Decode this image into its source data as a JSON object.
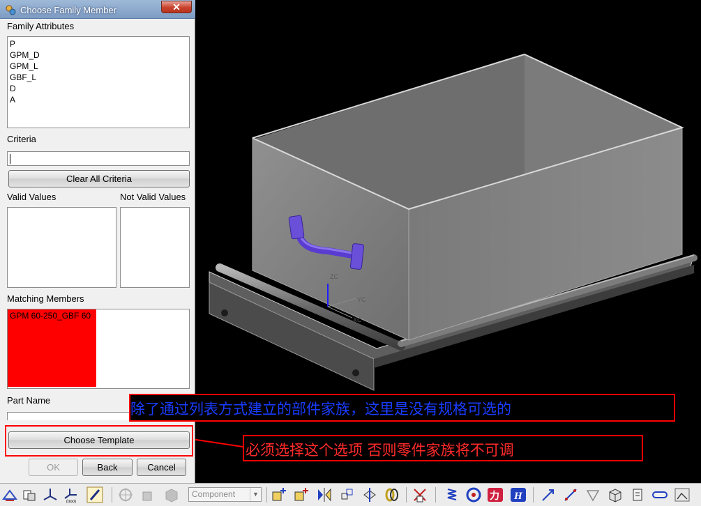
{
  "dialog": {
    "title": "Choose Family Member",
    "close_glyph": "✕",
    "family_attributes_label": "Family Attributes",
    "family_attributes": [
      "P",
      "GPM_D",
      "GPM_L",
      "GBF_L",
      "D",
      "A"
    ],
    "criteria_label": "Criteria",
    "criteria_value": "",
    "clear_criteria_button": "Clear All Criteria",
    "valid_values_label": "Valid Values",
    "not_valid_values_label": "Not Valid Values",
    "matching_members_label": "Matching Members",
    "matching_members": [
      "GPM 60-250_GBF 60"
    ],
    "part_name_label": "Part Name",
    "choose_template_button": "Choose Template",
    "ok_button": "OK",
    "back_button": "Back",
    "cancel_button": "Cancel"
  },
  "annotations": {
    "note1": "除了通过列表方式建立的部件家族，这里是没有规格可选的",
    "note2": "必须选择这个选项 否则零件家族将不可调",
    "note1_color": "#1a3cff",
    "note2_color": "#ff2a2a",
    "frame_color": "#ff0000"
  },
  "viewport": {
    "axis_z": "ZC",
    "axis_y": "YC",
    "axis_x": "XC",
    "background": "#000000",
    "part_color": "#8a8a8a",
    "handle_color": "#6a4fd8"
  },
  "toolbar": {
    "component_select": "Component",
    "icons": [
      "wave-geometry-icon",
      "assembly-constraints-icon",
      "csys-icon",
      "point-set-icon",
      "paint-brush-icon",
      "snap-point-icon",
      "move-component-icon",
      "shaded-box-icon",
      "add-component-icon",
      "new-component-icon",
      "mirror-assembly-icon",
      "reposition-icon",
      "show-product-outline-icon",
      "link-chain-icon",
      "explode-view-icon",
      "spring-icon",
      "section-icon",
      "ka-icon",
      "h-icon",
      "vector-icon",
      "dimension-icon",
      "expression-icon",
      "trim-box-icon",
      "drafting-icon",
      "slot-icon",
      "image-icon"
    ]
  }
}
